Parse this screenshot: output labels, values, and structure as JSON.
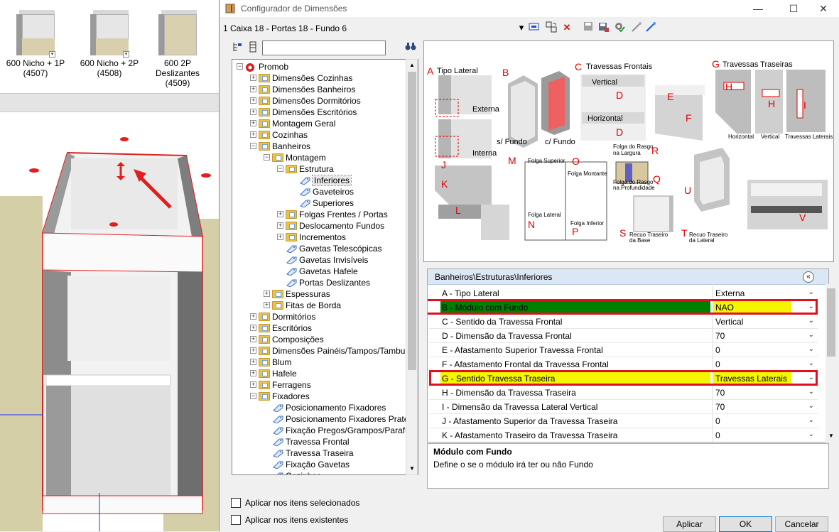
{
  "thumbs": [
    {
      "label": "600 Nicho + 1P",
      "code": "(4507)"
    },
    {
      "label": "600 Nicho + 2P",
      "code": "(4508)"
    },
    {
      "label": "600 2P Deslizantes",
      "code": "(4509)"
    }
  ],
  "dialog": {
    "title": "Configurador de Dimensões",
    "doc_title": "1 Caixa 18 - Portas 18 - Fundo 6",
    "minimize": "—",
    "maximize": "☐",
    "close": "✕"
  },
  "tree": {
    "search_value": "",
    "rows": [
      {
        "label": "Promob",
        "level": 0,
        "type": "root",
        "exp": "−"
      },
      {
        "label": "Dimensões Cozinhas",
        "level": 1,
        "type": "folder",
        "exp": "+"
      },
      {
        "label": "Dimensões Banheiros",
        "level": 1,
        "type": "folder",
        "exp": "+"
      },
      {
        "label": "Dimensões Dormitórios",
        "level": 1,
        "type": "folder",
        "exp": "+"
      },
      {
        "label": "Dimensões Escritórios",
        "level": 1,
        "type": "folder",
        "exp": "+"
      },
      {
        "label": "Montagem Geral",
        "level": 1,
        "type": "folder",
        "exp": "+"
      },
      {
        "label": "Cozinhas",
        "level": 1,
        "type": "folder",
        "exp": "+"
      },
      {
        "label": "Banheiros",
        "level": 1,
        "type": "folder",
        "exp": "−"
      },
      {
        "label": "Montagem",
        "level": 2,
        "type": "folder",
        "exp": "−"
      },
      {
        "label": "Estrutura",
        "level": 3,
        "type": "folder",
        "exp": "−"
      },
      {
        "label": "Inferiores",
        "level": 4,
        "type": "leaf",
        "exp": "",
        "selected": true
      },
      {
        "label": "Gaveteiros",
        "level": 4,
        "type": "leaf",
        "exp": ""
      },
      {
        "label": "Superiores",
        "level": 4,
        "type": "leaf",
        "exp": ""
      },
      {
        "label": "Folgas Frentes / Portas",
        "level": 3,
        "type": "folder",
        "exp": "+"
      },
      {
        "label": "Deslocamento Fundos",
        "level": 3,
        "type": "folder",
        "exp": "+"
      },
      {
        "label": "Incrementos",
        "level": 3,
        "type": "folder",
        "exp": "+"
      },
      {
        "label": "Gavetas Telescópicas",
        "level": 3,
        "type": "leaf",
        "exp": ""
      },
      {
        "label": "Gavetas Invisíveis",
        "level": 3,
        "type": "leaf",
        "exp": ""
      },
      {
        "label": "Gavetas Hafele",
        "level": 3,
        "type": "leaf",
        "exp": ""
      },
      {
        "label": "Portas Deslizantes",
        "level": 3,
        "type": "leaf",
        "exp": ""
      },
      {
        "label": "Espessuras",
        "level": 2,
        "type": "folder",
        "exp": "+"
      },
      {
        "label": "Fitas de Borda",
        "level": 2,
        "type": "folder",
        "exp": "+"
      },
      {
        "label": "Dormitórios",
        "level": 1,
        "type": "folder",
        "exp": "+"
      },
      {
        "label": "Escritórios",
        "level": 1,
        "type": "folder",
        "exp": "+"
      },
      {
        "label": "Composições",
        "level": 1,
        "type": "folder",
        "exp": "+"
      },
      {
        "label": "Dimensões Painéis/Tampos/Tamburat",
        "level": 1,
        "type": "folder",
        "exp": "+"
      },
      {
        "label": "Blum",
        "level": 1,
        "type": "folder",
        "exp": "+"
      },
      {
        "label": "Hafele",
        "level": 1,
        "type": "folder",
        "exp": "+"
      },
      {
        "label": "Ferragens",
        "level": 1,
        "type": "folder",
        "exp": "+"
      },
      {
        "label": "Fixadores",
        "level": 1,
        "type": "folder",
        "exp": "−"
      },
      {
        "label": "Posicionamento Fixadores",
        "level": 2,
        "type": "leaf",
        "exp": ""
      },
      {
        "label": "Posicionamento Fixadores Prateleir",
        "level": 2,
        "type": "leaf",
        "exp": ""
      },
      {
        "label": "Fixação Pregos/Grampos/Parafuso",
        "level": 2,
        "type": "leaf",
        "exp": ""
      },
      {
        "label": "Travessa Frontal",
        "level": 2,
        "type": "leaf",
        "exp": ""
      },
      {
        "label": "Travessa Traseira",
        "level": 2,
        "type": "leaf",
        "exp": ""
      },
      {
        "label": "Fixação Gavetas",
        "level": 2,
        "type": "leaf",
        "exp": ""
      },
      {
        "label": "Cozinhas",
        "level": 2,
        "type": "leaf",
        "exp": ""
      }
    ]
  },
  "checkboxes": {
    "selected_items": "Aplicar nos itens selecionados",
    "existing_items": "Aplicar nos itens existentes"
  },
  "diagram": {
    "a_letter": "A",
    "a_title": "Tipo Lateral",
    "a_ext": "Externa",
    "a_int": "Interna",
    "b_letter": "B",
    "b_sfundo": "s/ Fundo",
    "b_cfundo": "c/ Fundo",
    "c_letter": "C",
    "c_title": "Travessas Frontais",
    "c_vertical": "Vertical",
    "c_horizontal": "Horizontal",
    "d_letter": "D",
    "e_letter": "E",
    "f_letter": "F",
    "g_letter": "G",
    "g_title": "Travessas Traseiras",
    "h_letter": "H",
    "i_letter": "I",
    "g_horizontal": "Horizontal",
    "g_vertical": "Vertical",
    "g_laterais": "Travessas Laterais",
    "j_letter": "J",
    "k_letter": "K",
    "l_letter": "L",
    "m_letter": "M",
    "n_letter": "N",
    "o_letter": "O",
    "p_letter": "P",
    "folga_superior": "Folga Superior",
    "folga_montante": "Folga Montante",
    "folga_lateral": "Folga Lateral",
    "folga_inferior": "Folga Inferior",
    "r_letter": "R",
    "q_letter": "Q",
    "rasgo_largura_1": "Folga do Rasgo",
    "rasgo_largura_2": "na Largura",
    "rasgo_prof_1": "Folga do Rasgo",
    "rasgo_prof_2": "na Profundidade",
    "s_letter": "S",
    "t_letter": "T",
    "u_letter": "U",
    "v_letter": "V",
    "recuo_base_1": "Recuo Traseiro",
    "recuo_base_2": "da Base",
    "recuo_lat_1": "Recuo Traseiro",
    "recuo_lat_2": "da Lateral"
  },
  "grid": {
    "header": "Banheiros\\Estruturas\\Inferiores",
    "collapse": "«",
    "rows": [
      {
        "name": "A - Tipo Lateral",
        "value": "Externa",
        "highlight": "none"
      },
      {
        "name": "B - Módulo com Fundo",
        "value": "NAO",
        "highlight": "green"
      },
      {
        "name": "C - Sentido da Travessa Frontal",
        "value": "Vertical",
        "highlight": "none"
      },
      {
        "name": "D - Dimensão da Travessa Frontal",
        "value": "70",
        "highlight": "none"
      },
      {
        "name": "E - Afastamento Superior Travessa Frontal",
        "value": "0",
        "highlight": "none"
      },
      {
        "name": "F - Afastamento Frontal da Travessa Frontal",
        "value": "0",
        "highlight": "none"
      },
      {
        "name": "G - Sentido Travessa Traseira",
        "value": "Travessas Laterais",
        "highlight": "yellow"
      },
      {
        "name": "H - Dimensão da Travessa Traseira",
        "value": "70",
        "highlight": "none"
      },
      {
        "name": "I - Dimensão da Travessa Lateral Vertical",
        "value": "70",
        "highlight": "none"
      },
      {
        "name": "J - Afastamento Superior da Travessa Traseira",
        "value": "0",
        "highlight": "none"
      },
      {
        "name": "K - Afastamento Traseiro da Travessa Traseira",
        "value": "0",
        "highlight": "none"
      }
    ]
  },
  "description": {
    "title": "Módulo com Fundo",
    "text": "Define o se o módulo irá ter ou não Fundo"
  },
  "buttons": {
    "apply": "Aplicar",
    "ok": "OK",
    "cancel": "Cancelar"
  },
  "colors": {
    "green": "#008000",
    "yellow": "#f5f500",
    "red_frame": "#e0101e"
  }
}
